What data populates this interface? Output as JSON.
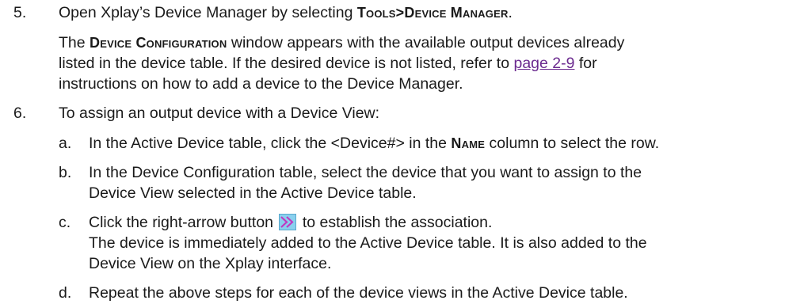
{
  "step5": {
    "num": "5.",
    "text_a": "Open Xplay’s Device Manager by selecting ",
    "menu_path": "Tools>Device Manager",
    "text_b": ".",
    "para1_a": "The ",
    "window_name": "Device Configuration",
    "para1_b": " window appears with the available output devices already",
    "para2": "listed in the device table. If the desired device is not listed, refer to ",
    "link": "page 2-9",
    "para2_b": " for",
    "para3": "instructions on how to add a device to the Device Manager."
  },
  "step6": {
    "num": "6.",
    "text": "To assign an output device with a Device View:",
    "a": {
      "letter": "a.",
      "text_a": "In the Active Device table, click the <Device#> in the ",
      "column": "Name",
      "text_b": " column to select the row."
    },
    "b": {
      "letter": "b.",
      "line1": "In the Device Configuration table, select the device that you want to assign to the",
      "line2": "Device View selected in the Active Device table."
    },
    "c": {
      "letter": "c.",
      "text_a": "Click the right-arrow button ",
      "button_icon": "double-right-arrow-icon",
      "text_b": " to establish the association.",
      "line2": "The device is immediately added to the Active Device table. It is also added to the",
      "line3": "Device View on the Xplay interface."
    },
    "d": {
      "letter": "d.",
      "text": "Repeat the above steps for each of the device views in the Active Device table."
    }
  },
  "colors": {
    "text": "#1a1a1a",
    "link": "#6b2a8f",
    "button_bg": "#8ad0ee",
    "button_arrow": "#c03ac0"
  }
}
